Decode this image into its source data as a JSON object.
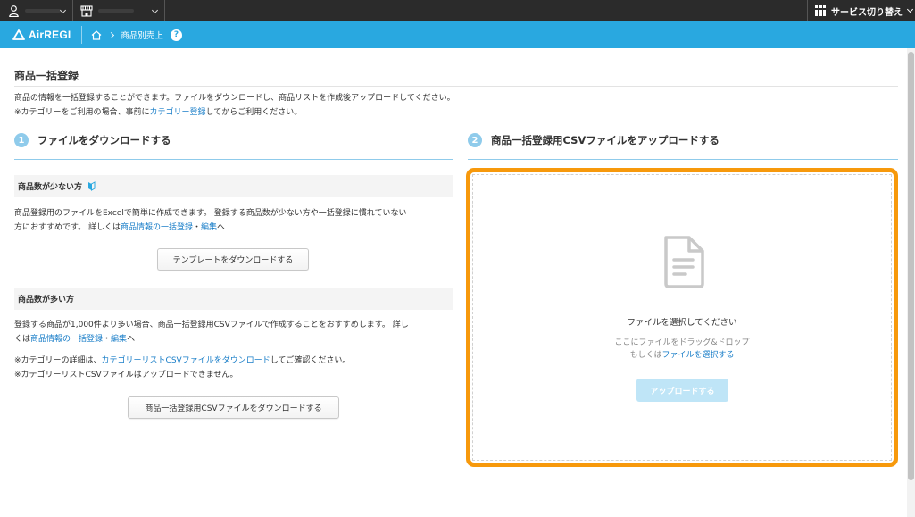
{
  "topbar": {
    "service_switch_label": "サービス切り替え"
  },
  "header": {
    "logo_text": "AirREGI",
    "breadcrumb_current": "商品別売上",
    "help_glyph": "?"
  },
  "page": {
    "title": "商品一括登録",
    "desc_line1": "商品の情報を一括登録することができます。ファイルをダウンロードし、商品リストを作成後アップロードしてください。",
    "desc_line2_prefix": "※カテゴリーをご利用の場合、事前に",
    "desc_line2_link": "カテゴリー登録",
    "desc_line2_suffix": "してからご利用ください。"
  },
  "step1": {
    "number": "1",
    "title": "ファイルをダウンロードする",
    "few": {
      "heading": "商品数が少ない方",
      "text_line1": "商品登録用のファイルをExcelで簡単に作成できます。 登録する商品数が少ない方や一括登録に慣れていない",
      "text_line2_prefix": "方におすすめです。 詳しくは",
      "link1": "商品情報の一括登録",
      "middot": "・",
      "link2": "編集",
      "suffix": "へ",
      "button": "テンプレートをダウンロードする"
    },
    "many": {
      "heading": "商品数が多い方",
      "text_line1": "登録する商品が1,000件より多い場合、商品一括登録用CSVファイルで作成することをおすすめします。 詳し",
      "text_line2_prefix": "くは",
      "link1": "商品情報の一括登録",
      "middot": "・",
      "link2": "編集",
      "suffix": "へ",
      "note1_prefix": "※カテゴリーの詳細は、",
      "note1_link": "カテゴリーリストCSVファイルをダウンロード",
      "note1_suffix": "してご確認ください。",
      "note2": "※カテゴリーリストCSVファイルはアップロードできません。",
      "button": "商品一括登録用CSVファイルをダウンロードする"
    }
  },
  "step2": {
    "number": "2",
    "title": "商品一括登録用CSVファイルをアップロードする",
    "drop": {
      "title": "ファイルを選択してください",
      "hint_line1": "ここにファイルをドラッグ&ドロップ",
      "hint_line2_prefix": "もしくは",
      "hint_line2_link": "ファイルを選択する",
      "upload_button": "アップロードする"
    }
  },
  "colors": {
    "header_blue": "#29a8e0",
    "link_blue": "#1a7ec8",
    "highlight_orange": "#f7990c",
    "step_badge": "#8fcbeb",
    "upload_disabled": "#bfe5f7"
  }
}
